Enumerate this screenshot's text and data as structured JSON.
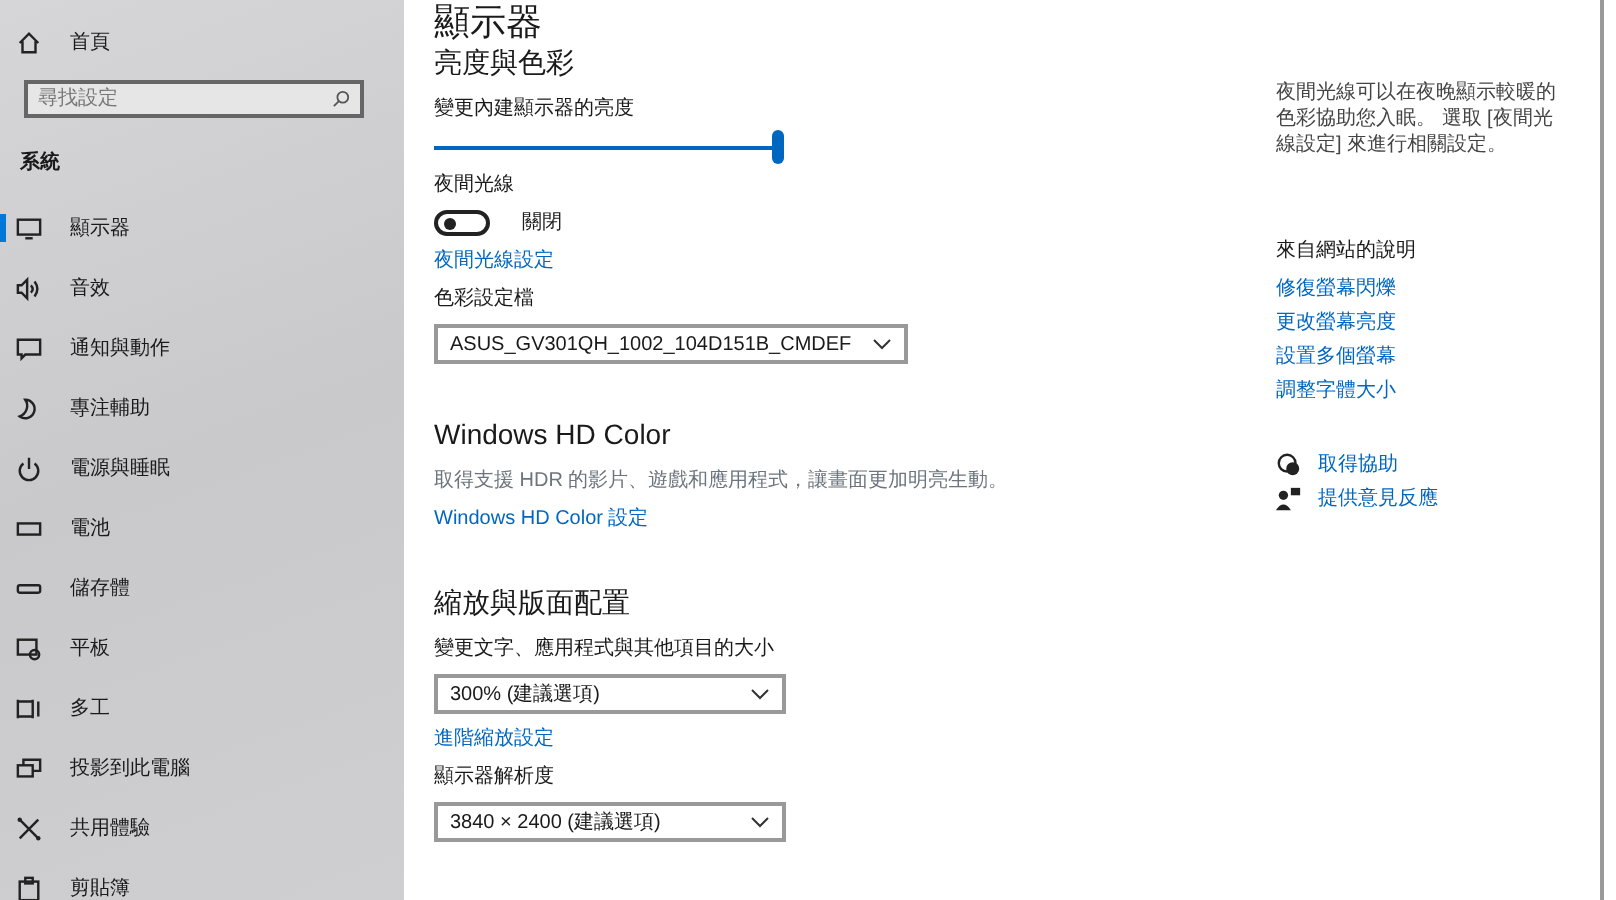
{
  "sidebar": {
    "home": {
      "label": "首頁"
    },
    "search": {
      "placeholder": "尋找設定"
    },
    "section": "系統",
    "items": [
      {
        "label": "顯示器",
        "selected": true
      },
      {
        "label": "音效",
        "selected": false
      },
      {
        "label": "通知與動作",
        "selected": false
      },
      {
        "label": "專注輔助",
        "selected": false
      },
      {
        "label": "電源與睡眠",
        "selected": false
      },
      {
        "label": "電池",
        "selected": false
      },
      {
        "label": "儲存體",
        "selected": false
      },
      {
        "label": "平板",
        "selected": false
      },
      {
        "label": "多工",
        "selected": false
      },
      {
        "label": "投影到此電腦",
        "selected": false
      },
      {
        "label": "共用體驗",
        "selected": false
      },
      {
        "label": "剪貼簿",
        "selected": false
      }
    ]
  },
  "main": {
    "title": "顯示器",
    "sections": [
      {
        "heading": "亮度與色彩",
        "items": [
          {
            "kind": "label",
            "text": "變更內建顯示器的亮度"
          },
          {
            "kind": "slider",
            "level": 1
          },
          {
            "kind": "label",
            "text": "夜間光線"
          },
          {
            "kind": "toggle",
            "on": false,
            "text": "關閉"
          },
          {
            "kind": "link",
            "text": "夜間光線設定"
          },
          {
            "kind": "label",
            "text": "色彩設定檔"
          },
          {
            "kind": "select",
            "value": "ASUS_GV301QH_1002_104D151B_CMDEF"
          }
        ]
      },
      {
        "heading": "Windows HD Color",
        "items": [
          {
            "kind": "text",
            "text": "取得支援 HDR 的影片、遊戲和應用程式，讓畫面更加明亮生動。"
          },
          {
            "kind": "link",
            "text": "Windows HD Color 設定"
          }
        ]
      },
      {
        "heading": "縮放與版面配置",
        "items": [
          {
            "kind": "label",
            "text": "變更文字、應用程式與其他項目的大小"
          },
          {
            "kind": "select",
            "value": "300% (建議選項)"
          },
          {
            "kind": "link",
            "text": "進階縮放設定"
          },
          {
            "kind": "label",
            "text": "顯示器解析度"
          },
          {
            "kind": "select",
            "value": "3840 × 2400 (建議選項)"
          }
        ]
      }
    ]
  },
  "aside": {
    "description": "夜間光線可以在夜晚顯示較暖的色彩協助您入眠。 選取 [夜間光線設定] 來進行相關設定。",
    "help_heading": "來自網站的說明",
    "help_links": [
      "修復螢幕閃爍",
      "更改螢幕亮度",
      "設置多個螢幕",
      "調整字體大小"
    ],
    "actions": [
      {
        "label": "取得協助"
      },
      {
        "label": "提供意見反應"
      }
    ]
  }
}
